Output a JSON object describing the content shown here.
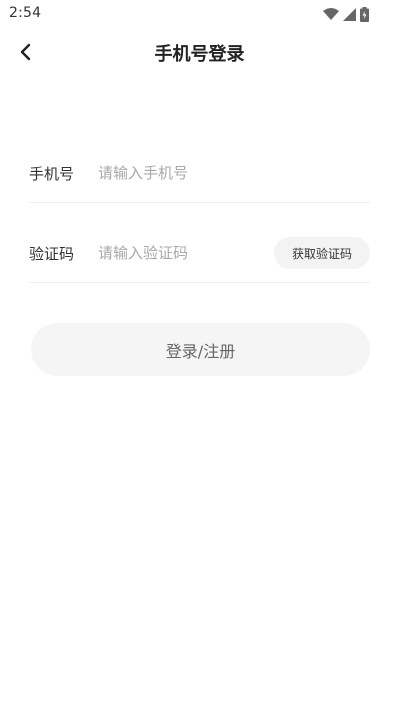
{
  "status_bar": {
    "time": "2:54",
    "icons": [
      "wifi-icon",
      "signal-icon",
      "battery-icon"
    ]
  },
  "header": {
    "back_icon": "chevron-left-icon",
    "title": "手机号登录"
  },
  "form": {
    "phone": {
      "label": "手机号",
      "value": "",
      "placeholder": "请输入手机号"
    },
    "code": {
      "label": "验证码",
      "value": "",
      "placeholder": "请输入验证码",
      "get_code_label": "获取验证码"
    },
    "submit_label": "登录/注册"
  },
  "colors": {
    "title": "#222222",
    "placeholder": "#a8a8a8",
    "divider": "#eeeeee",
    "button_bg": "#f5f5f5",
    "submit_text": "#666666"
  }
}
